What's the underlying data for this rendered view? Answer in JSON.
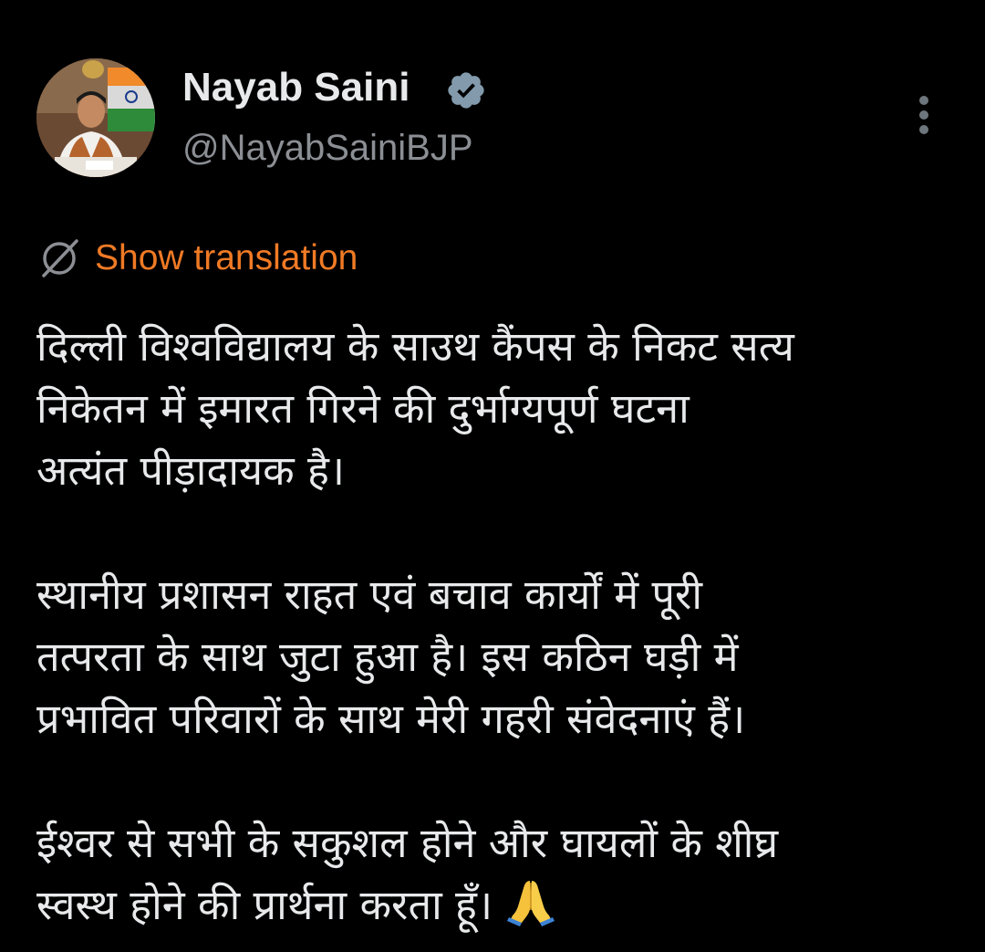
{
  "author": {
    "display_name": "Nayab Saini",
    "handle": "@NayabSainiBJP",
    "verified": true,
    "avatar": "profile-photo"
  },
  "icons": {
    "verified": "verified-badge-icon",
    "more": "more-vertical-icon",
    "translate": "globe-slash-icon",
    "folded_hands": "folded-hands-emoji"
  },
  "colors": {
    "background": "#000000",
    "text": "#e7e9ea",
    "secondary_text": "#8b8f94",
    "accent": "#f07a25"
  },
  "translate": {
    "label": "Show translation"
  },
  "tweet": {
    "paragraphs": [
      {
        "lines": [
          "दिल्ली विश्वविद्यालय के साउथ कैंपस के निकट सत्य",
          "निकेतन में इमारत गिरने की दुर्भाग्यपूर्ण घटना",
          "अत्यंत पीड़ादायक है।"
        ]
      },
      {
        "lines": [
          "स्थानीय प्रशासन राहत एवं बचाव कार्यों में पूरी",
          "तत्परता के साथ जुटा हुआ है। इस कठिन घड़ी में",
          "प्रभावित परिवारों के साथ मेरी गहरी संवेदनाएं हैं।"
        ]
      },
      {
        "lines": [
          "ईश्वर से सभी के सकुशल होने और घायलों के शीघ्र",
          "स्वस्थ होने की प्रार्थना करता हूँ।"
        ],
        "emoji": "🙏"
      }
    ]
  }
}
